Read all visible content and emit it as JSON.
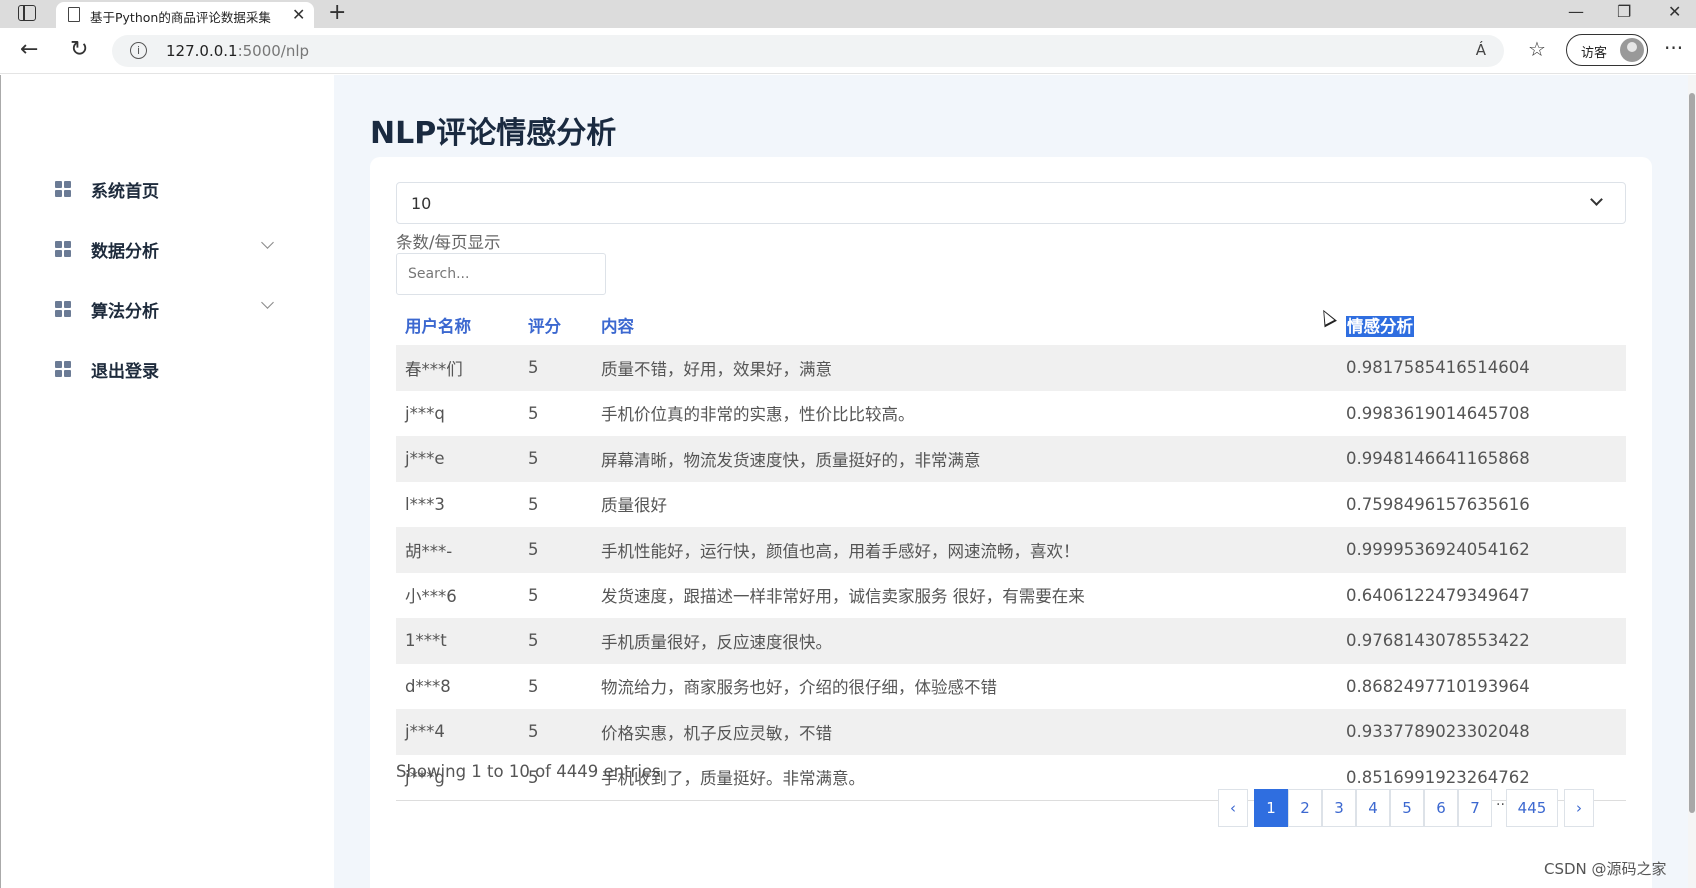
{
  "browser": {
    "tab_title": "基于Python的商品评论数据采集",
    "url_host": "127.0.0.1",
    "url_path": ":5000/nlp",
    "profile_label": "访客",
    "read_aloud": "Á",
    "info_glyph": "i"
  },
  "sidebar": {
    "items": [
      {
        "label": "系统首页",
        "has_submenu": false
      },
      {
        "label": "数据分析",
        "has_submenu": true
      },
      {
        "label": "算法分析",
        "has_submenu": true
      },
      {
        "label": "退出登录",
        "has_submenu": false
      }
    ]
  },
  "page": {
    "title": "NLP评论情感分析",
    "page_size_value": "10",
    "page_size_label": "条数/每页显示",
    "search_placeholder": "Search..."
  },
  "table": {
    "columns": [
      "用户名称",
      "评分",
      "内容",
      "情感分析"
    ],
    "rows": [
      [
        "春***们",
        "5",
        "质量不错，好用，效果好，满意",
        "0.9817585416514604"
      ],
      [
        "j***q",
        "5",
        "手机价位真的非常的实惠，性价比比较高。",
        "0.9983619014645708"
      ],
      [
        "j***e",
        "5",
        "屏幕清晰，物流发货速度快，质量挺好的，非常满意",
        "0.9948146641165868"
      ],
      [
        "l***3",
        "5",
        "质量很好",
        "0.7598496157635616"
      ],
      [
        "胡***-",
        "5",
        "手机性能好，运行快，颜值也高，用着手感好，网速流畅，喜欢！",
        "0.9999536924054162"
      ],
      [
        "小***6",
        "5",
        "发货速度，跟描述一样非常好用，诚信卖家服务 很好，有需要在来",
        "0.6406122479349647"
      ],
      [
        "1***t",
        "5",
        "手机质量很好，反应速度很快。",
        "0.9768143078553422"
      ],
      [
        "d***8",
        "5",
        "物流给力，商家服务也好，介绍的很仔细，体验感不错",
        "0.8682497710193964"
      ],
      [
        "j***4",
        "5",
        "价格实惠，机子反应灵敏，不错",
        "0.9337789023302048"
      ],
      [
        "j***g",
        "5",
        "手机收到了，质量挺好。非常满意。",
        "0.8516991923264762"
      ]
    ]
  },
  "footer": {
    "entries_info": "Showing 1 to 10 of 4449 entries",
    "pages": [
      "1",
      "2",
      "3",
      "4",
      "5",
      "6",
      "7"
    ],
    "ellipsis": "···",
    "last_page": "445",
    "prev": "‹",
    "next": "›",
    "active_page": "1"
  },
  "watermark": "CSDN @源码之家",
  "colors": {
    "accent": "#2f6ee0",
    "header_text": "#3c68d0",
    "main_bg": "#f2f6fb"
  }
}
